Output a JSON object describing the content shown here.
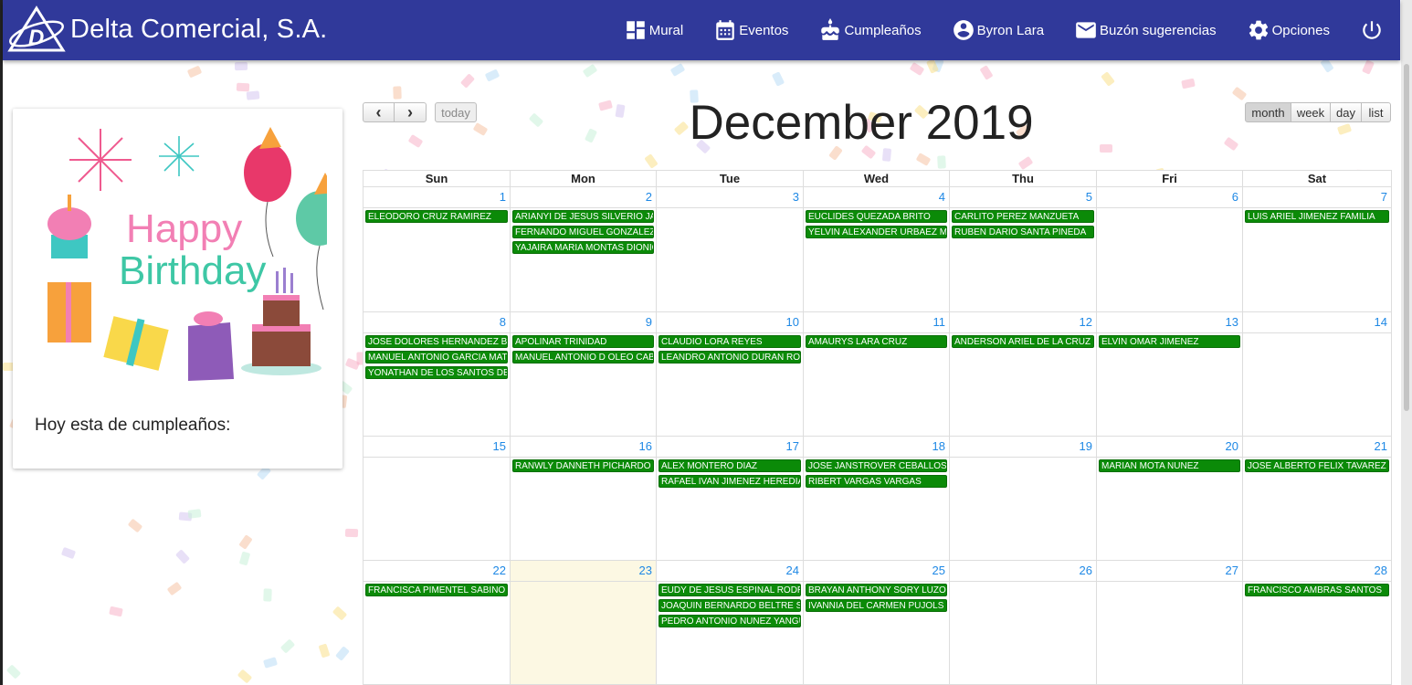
{
  "brand": {
    "title": "Delta Comercial, S.A.",
    "logo_icon": "delta-logo-icon"
  },
  "nav": [
    {
      "label": "Mural",
      "icon": "dashboard-icon"
    },
    {
      "label": "Eventos",
      "icon": "calendar-icon"
    },
    {
      "label": "Cumpleaños",
      "icon": "cake-icon"
    },
    {
      "label": "Byron Lara",
      "icon": "account-icon"
    },
    {
      "label": "Buzón sugerencias",
      "icon": "mail-icon"
    },
    {
      "label": "Opciones",
      "icon": "gear-icon"
    },
    {
      "label": "",
      "icon": "power-icon"
    }
  ],
  "birthday_card": {
    "art_line1": "Happy",
    "art_line2": "Birthday",
    "caption": "Hoy esta de cumpleaños:"
  },
  "calendar": {
    "title": "December 2019",
    "prev_label": "‹",
    "next_label": "›",
    "today_label": "today",
    "views": [
      "month",
      "week",
      "day",
      "list"
    ],
    "active_view": "month",
    "weekdays": [
      "Sun",
      "Mon",
      "Tue",
      "Wed",
      "Thu",
      "Fri",
      "Sat"
    ],
    "weeks": [
      [
        {
          "day": "1",
          "events": [
            "ELEODORO CRUZ RAMIREZ"
          ]
        },
        {
          "day": "2",
          "events": [
            "ARIANYI DE JESUS SILVERIO JAQUEZ",
            "FERNANDO MIGUEL GONZALEZ BRITO",
            "YAJAIRA MARIA MONTAS DIONICIO"
          ]
        },
        {
          "day": "3",
          "events": []
        },
        {
          "day": "4",
          "events": [
            "EUCLIDES QUEZADA BRITO",
            "YELVIN ALEXANDER URBAEZ MEDINA"
          ]
        },
        {
          "day": "5",
          "events": [
            "CARLITO PEREZ MANZUETA",
            "RUBEN DARIO SANTA PINEDA"
          ]
        },
        {
          "day": "6",
          "events": []
        },
        {
          "day": "7",
          "events": [
            "LUIS ARIEL JIMENEZ FAMILIA"
          ]
        }
      ],
      [
        {
          "day": "8",
          "events": [
            "JOSE DOLORES HERNANDEZ BAUTISTA",
            "MANUEL ANTONIO GARCIA MATEO",
            "YONATHAN DE LOS SANTOS DE LEON"
          ]
        },
        {
          "day": "9",
          "events": [
            "APOLINAR TRINIDAD",
            "MANUEL ANTONIO D OLEO CABRERA"
          ]
        },
        {
          "day": "10",
          "events": [
            "CLAUDIO LORA REYES",
            "LEANDRO ANTONIO DURAN RODRIGUEZ"
          ]
        },
        {
          "day": "11",
          "events": [
            "AMAURYS LARA CRUZ"
          ]
        },
        {
          "day": "12",
          "events": [
            "ANDERSON ARIEL DE LA CRUZ"
          ]
        },
        {
          "day": "13",
          "events": [
            "ELVIN OMAR JIMENEZ"
          ]
        },
        {
          "day": "14",
          "events": []
        }
      ],
      [
        {
          "day": "15",
          "events": []
        },
        {
          "day": "16",
          "events": [
            "RANWLY DANNETH PICHARDO DIAZ"
          ]
        },
        {
          "day": "17",
          "events": [
            "ALEX MONTERO DIAZ",
            "RAFAEL IVAN JIMENEZ HEREDIA"
          ]
        },
        {
          "day": "18",
          "events": [
            "JOSE JANSTROVER CEBALLOS ROSARIO",
            "RIBERT VARGAS VARGAS"
          ]
        },
        {
          "day": "19",
          "events": []
        },
        {
          "day": "20",
          "events": [
            "MARIAN MOTA NUNEZ"
          ]
        },
        {
          "day": "21",
          "events": [
            "JOSE ALBERTO FELIX TAVAREZ"
          ]
        }
      ],
      [
        {
          "day": "22",
          "events": [
            "FRANCISCA PIMENTEL SABINO"
          ]
        },
        {
          "day": "23",
          "events": [],
          "today": true
        },
        {
          "day": "24",
          "events": [
            "EUDY DE JESUS ESPINAL RODRIGUEZ",
            "JOAQUIN BERNARDO BELTRE SEVERINO",
            "PEDRO ANTONIO NUNEZ YANGUELA"
          ]
        },
        {
          "day": "25",
          "events": [
            "BRAYAN ANTHONY SORY LUZON",
            "IVANNIA DEL CARMEN PUJOLS SANCHEZ"
          ]
        },
        {
          "day": "26",
          "events": []
        },
        {
          "day": "27",
          "events": []
        },
        {
          "day": "28",
          "events": [
            "FRANCISCO AMBRAS SANTOS"
          ]
        }
      ]
    ]
  },
  "colors": {
    "navbar": "#30399a",
    "event": "#0b8a08",
    "day_number": "#1e88e5",
    "today_bg": "#fcf8e3"
  }
}
